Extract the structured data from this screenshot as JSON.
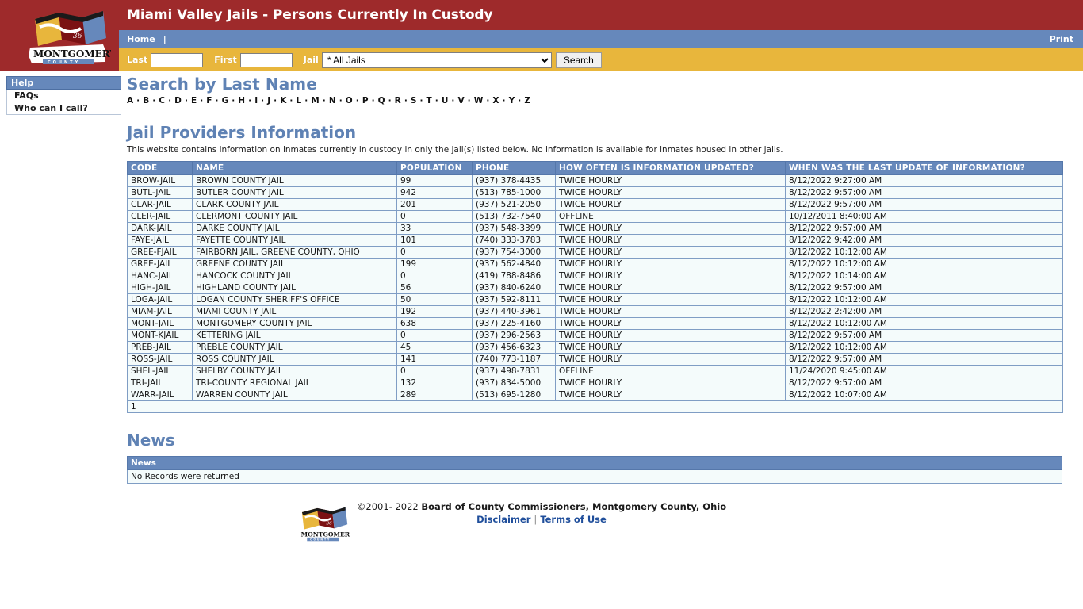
{
  "header": {
    "site_title": "Miami Valley Jails - Persons Currently In Custody",
    "logo_alt": "montgomery-county-logo",
    "nav": {
      "home_label": "Home",
      "separator": "|",
      "print_label": "Print"
    },
    "search": {
      "last_label": "Last",
      "last_value": "",
      "last_placeholder": "",
      "first_label": "First",
      "first_value": "",
      "first_placeholder": "",
      "jail_label": "Jail",
      "jail_selected": "* All Jails",
      "jail_options": [
        "* All Jails"
      ],
      "search_button": "Search"
    },
    "colors": {
      "banner_maroon": "#9e2a2b",
      "nav_blue": "#6688bb",
      "search_gold": "#e8b63c"
    }
  },
  "sidebar": {
    "title": "Help",
    "items": [
      {
        "label": "FAQs"
      },
      {
        "label": "Who can I call?"
      }
    ]
  },
  "main": {
    "search_heading": "Search by Last Name",
    "alphabet": [
      "A",
      "B",
      "C",
      "D",
      "E",
      "F",
      "G",
      "H",
      "I",
      "J",
      "K",
      "L",
      "M",
      "N",
      "O",
      "P",
      "Q",
      "R",
      "S",
      "T",
      "U",
      "V",
      "W",
      "X",
      "Y",
      "Z"
    ],
    "alphabet_separator": "·",
    "providers_heading": "Jail Providers Information",
    "providers_description": "This website contains information on inmates currently in custody in only the jail(s) listed below. No information is available for inmates housed in other jails.",
    "table": {
      "columns": [
        "CODE",
        "NAME",
        "POPULATION",
        "PHONE",
        "HOW OFTEN IS INFORMATION UPDATED?",
        "WHEN WAS THE LAST UPDATE OF INFORMATION?"
      ],
      "rows": [
        [
          "BROW-JAIL",
          "BROWN COUNTY JAIL",
          "99",
          "(937) 378-4435",
          "TWICE HOURLY",
          "8/12/2022 9:27:00 AM"
        ],
        [
          "BUTL-JAIL",
          "BUTLER COUNTY JAIL",
          "942",
          "(513) 785-1000",
          "TWICE HOURLY",
          "8/12/2022 9:57:00 AM"
        ],
        [
          "CLAR-JAIL",
          "CLARK COUNTY JAIL",
          "201",
          "(937) 521-2050",
          "TWICE HOURLY",
          "8/12/2022 9:57:00 AM"
        ],
        [
          "CLER-JAIL",
          "CLERMONT COUNTY JAIL",
          "0",
          "(513) 732-7540",
          "OFFLINE",
          "10/12/2011 8:40:00 AM"
        ],
        [
          "DARK-JAIL",
          "DARKE COUNTY JAIL",
          "33",
          "(937) 548-3399",
          "TWICE HOURLY",
          "8/12/2022 9:57:00 AM"
        ],
        [
          "FAYE-JAIL",
          "FAYETTE COUNTY JAIL",
          "101",
          "(740) 333-3783",
          "TWICE HOURLY",
          "8/12/2022 9:42:00 AM"
        ],
        [
          "GREE-FJAIL",
          "FAIRBORN JAIL, GREENE COUNTY, OHIO",
          "0",
          "(937) 754-3000",
          "TWICE HOURLY",
          "8/12/2022 10:12:00 AM"
        ],
        [
          "GREE-JAIL",
          "GREENE COUNTY JAIL",
          "199",
          "(937) 562-4840",
          "TWICE HOURLY",
          "8/12/2022 10:12:00 AM"
        ],
        [
          "HANC-JAIL",
          "HANCOCK COUNTY JAIL",
          "0",
          "(419) 788-8486",
          "TWICE HOURLY",
          "8/12/2022 10:14:00 AM"
        ],
        [
          "HIGH-JAIL",
          "HIGHLAND COUNTY JAIL",
          "56",
          "(937) 840-6240",
          "TWICE HOURLY",
          "8/12/2022 9:57:00 AM"
        ],
        [
          "LOGA-JAIL",
          "LOGAN COUNTY SHERIFF'S OFFICE",
          "50",
          "(937) 592-8111",
          "TWICE HOURLY",
          "8/12/2022 10:12:00 AM"
        ],
        [
          "MIAM-JAIL",
          "MIAMI COUNTY JAIL",
          "192",
          "(937) 440-3961",
          "TWICE HOURLY",
          "8/12/2022 2:42:00 AM"
        ],
        [
          "MONT-JAIL",
          "MONTGOMERY COUNTY JAIL",
          "638",
          "(937) 225-4160",
          "TWICE HOURLY",
          "8/12/2022 10:12:00 AM"
        ],
        [
          "MONT-KJAIL",
          "KETTERING JAIL",
          "0",
          "(937) 296-2563",
          "TWICE HOURLY",
          "8/12/2022 9:57:00 AM"
        ],
        [
          "PREB-JAIL",
          "PREBLE COUNTY JAIL",
          "45",
          "(937) 456-6323",
          "TWICE HOURLY",
          "8/12/2022 10:12:00 AM"
        ],
        [
          "ROSS-JAIL",
          "ROSS COUNTY JAIL",
          "141",
          "(740) 773-1187",
          "TWICE HOURLY",
          "8/12/2022 9:57:00 AM"
        ],
        [
          "SHEL-JAIL",
          "SHELBY COUNTY JAIL",
          "0",
          "(937) 498-7831",
          "OFFLINE",
          "11/24/2020 9:45:00 AM"
        ],
        [
          "TRI-JAIL",
          "TRI-COUNTY REGIONAL JAIL",
          "132",
          "(937) 834-5000",
          "TWICE HOURLY",
          "8/12/2022 9:57:00 AM"
        ],
        [
          "WARR-JAIL",
          "WARREN COUNTY JAIL",
          "289",
          "(513) 695-1280",
          "TWICE HOURLY",
          "8/12/2022 10:07:00 AM"
        ]
      ],
      "pager": "1"
    },
    "news_heading": "News",
    "news_table": {
      "column": "News",
      "empty_message": "No Records were returned"
    }
  },
  "footer": {
    "logo_alt": "montgomery-county-logo",
    "copyright_prefix": "©2001- 2022 ",
    "copyright_entity": "Board of County Commissioners, Montgomery County, Ohio",
    "disclaimer_label": "Disclaimer",
    "links_separator": "|",
    "terms_label": "Terms of Use"
  }
}
